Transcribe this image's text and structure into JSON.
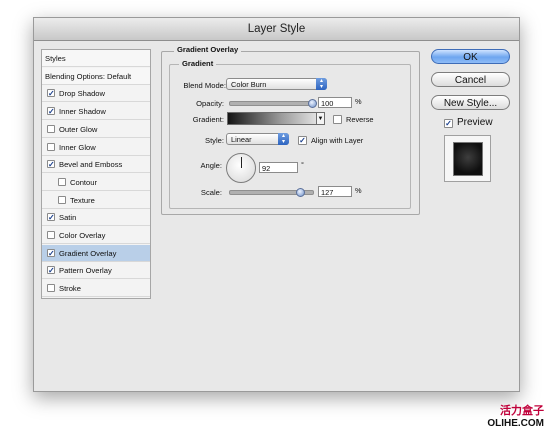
{
  "window": {
    "title": "Layer Style"
  },
  "styles_list": [
    {
      "label": "Styles",
      "type": "header"
    },
    {
      "label": "Blending Options: Default",
      "type": "header"
    },
    {
      "label": "Drop Shadow",
      "checked": true
    },
    {
      "label": "Inner Shadow",
      "checked": true
    },
    {
      "label": "Outer Glow",
      "checked": false
    },
    {
      "label": "Inner Glow",
      "checked": false
    },
    {
      "label": "Bevel and Emboss",
      "checked": true
    },
    {
      "label": "Contour",
      "checked": false,
      "sub": true
    },
    {
      "label": "Texture",
      "checked": false,
      "sub": true
    },
    {
      "label": "Satin",
      "checked": true
    },
    {
      "label": "Color Overlay",
      "checked": false
    },
    {
      "label": "Gradient Overlay",
      "checked": true,
      "selected": true
    },
    {
      "label": "Pattern Overlay",
      "checked": true
    },
    {
      "label": "Stroke",
      "checked": false
    }
  ],
  "panel": {
    "title": "Gradient Overlay",
    "group": "Gradient",
    "blend_mode_label": "Blend Mode:",
    "blend_mode_value": "Color Burn",
    "opacity_label": "Opacity:",
    "opacity_value": "100",
    "opacity_unit": "%",
    "opacity_level": 1.0,
    "gradient_label": "Gradient:",
    "reverse_label": "Reverse",
    "reverse_checked": false,
    "style_label": "Style:",
    "style_value": "Linear",
    "align_label": "Align with Layer",
    "align_checked": true,
    "angle_label": "Angle:",
    "angle_value": "92",
    "angle_unit": "°",
    "scale_label": "Scale:",
    "scale_value": "127",
    "scale_unit": "%",
    "scale_level": 0.85
  },
  "buttons": {
    "ok": "OK",
    "cancel": "Cancel",
    "new_style": "New Style...",
    "preview": "Preview",
    "preview_checked": true
  },
  "watermark": {
    "line1": "活力盒子",
    "line2": "OLIHE.COM"
  },
  "colors": {
    "accent": "#3e6cb7",
    "selection": "#b9cfe8"
  }
}
